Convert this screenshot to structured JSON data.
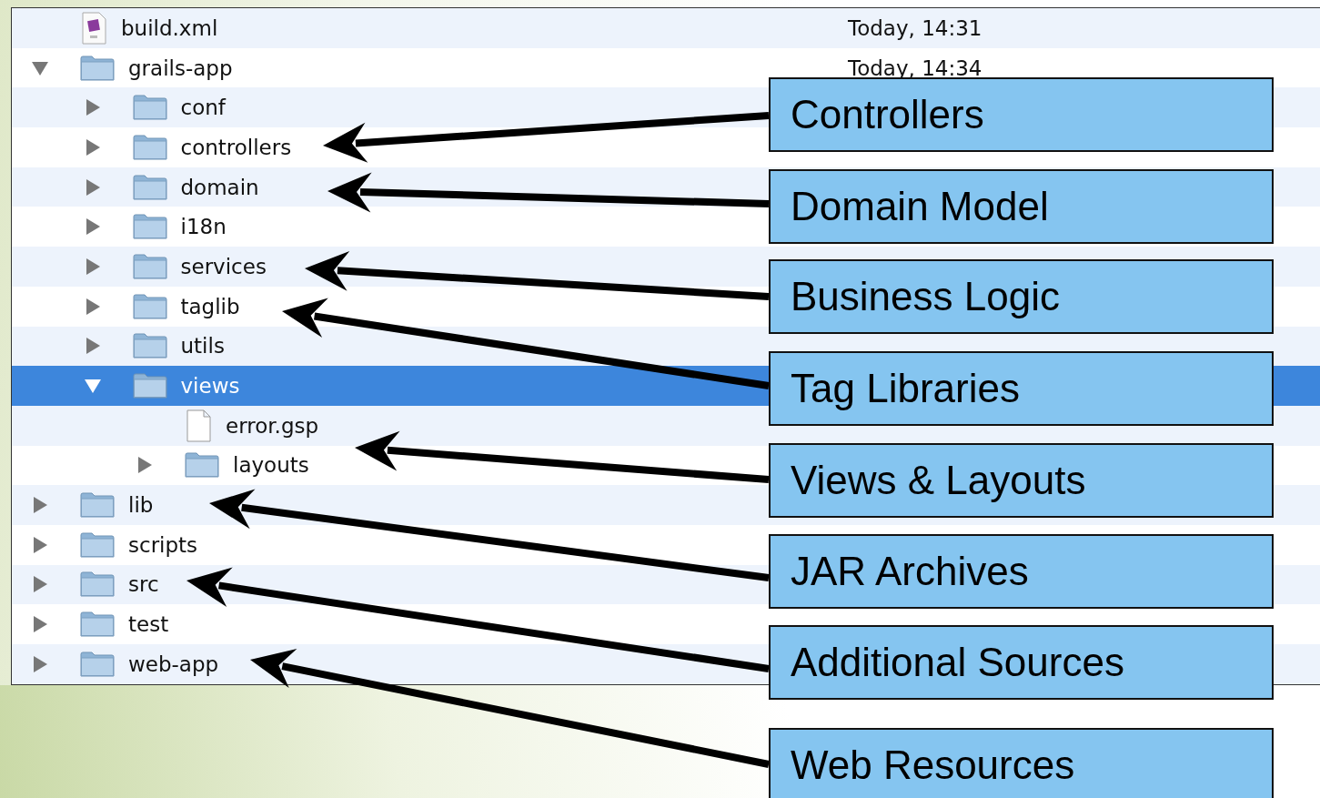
{
  "file_list": [
    {
      "name": "build.xml",
      "kind": "script",
      "date": "Today, 14:31"
    },
    {
      "name": "grails-app",
      "kind": "folder",
      "expanded": true,
      "selected": false,
      "date": "Today, 14:34",
      "children": [
        {
          "name": "conf",
          "kind": "folder",
          "expanded": false,
          "selected": false
        },
        {
          "name": "controllers",
          "kind": "folder",
          "expanded": false,
          "selected": false
        },
        {
          "name": "domain",
          "kind": "folder",
          "expanded": false,
          "selected": false
        },
        {
          "name": "i18n",
          "kind": "folder",
          "expanded": false,
          "selected": false
        },
        {
          "name": "services",
          "kind": "folder",
          "expanded": false,
          "selected": false
        },
        {
          "name": "taglib",
          "kind": "folder",
          "expanded": false,
          "selected": false
        },
        {
          "name": "utils",
          "kind": "folder",
          "expanded": false,
          "selected": false
        },
        {
          "name": "views",
          "kind": "folder",
          "expanded": true,
          "selected": true,
          "children": [
            {
              "name": "error.gsp",
              "kind": "document"
            },
            {
              "name": "layouts",
              "kind": "folder",
              "expanded": false,
              "selected": false
            }
          ]
        }
      ]
    },
    {
      "name": "lib",
      "kind": "folder",
      "expanded": false,
      "selected": false
    },
    {
      "name": "scripts",
      "kind": "folder",
      "expanded": false,
      "selected": false
    },
    {
      "name": "src",
      "kind": "folder",
      "expanded": false,
      "selected": false
    },
    {
      "name": "test",
      "kind": "folder",
      "expanded": false,
      "selected": false
    },
    {
      "name": "web-app",
      "kind": "folder",
      "expanded": false,
      "selected": false
    }
  ],
  "callouts": [
    {
      "label": "Controllers"
    },
    {
      "label": "Domain Model"
    },
    {
      "label": "Business Logic"
    },
    {
      "label": "Tag Libraries"
    },
    {
      "label": "Views & Layouts"
    },
    {
      "label": "JAR Archives"
    },
    {
      "label": "Additional Sources"
    },
    {
      "label": "Web Resources"
    }
  ]
}
